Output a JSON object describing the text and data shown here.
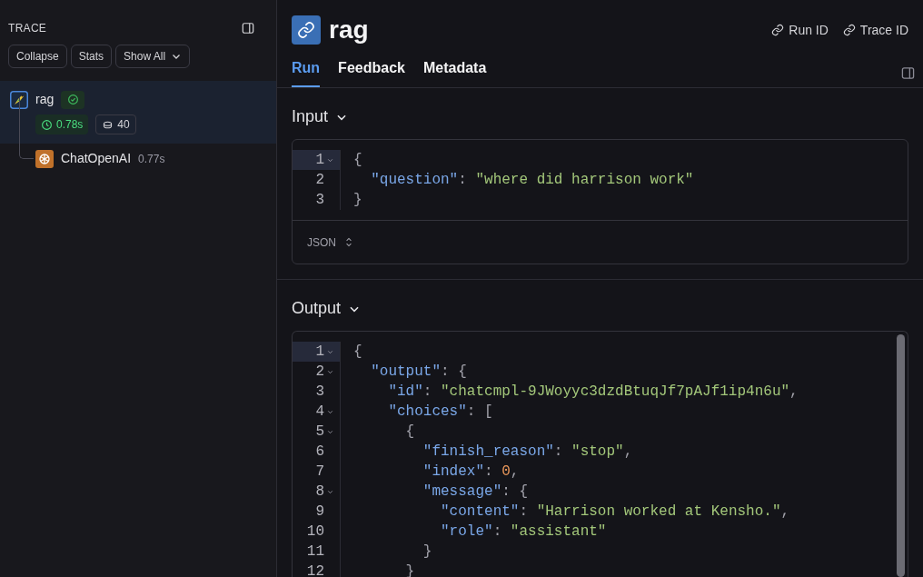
{
  "sidebar": {
    "title": "TRACE",
    "buttons": [
      {
        "label": "Collapse",
        "kind": "plain"
      },
      {
        "label": "Stats",
        "kind": "plain"
      },
      {
        "label": "Show All",
        "kind": "dropdown"
      }
    ],
    "runs": [
      {
        "name": "rag",
        "kind": "chain",
        "selected": true,
        "success": true,
        "latency": "0.78s",
        "tokens": "40",
        "children": [
          {
            "name": "ChatOpenAI",
            "kind": "llm",
            "selected": false,
            "latency": "0.77s"
          }
        ]
      }
    ]
  },
  "header": {
    "title": "rag",
    "links": [
      "Run ID",
      "Trace ID"
    ]
  },
  "tabs": [
    {
      "label": "Run",
      "selected": true
    },
    {
      "label": "Feedback",
      "selected": false
    },
    {
      "label": "Metadata",
      "selected": false
    }
  ],
  "sections": [
    {
      "title": "Input",
      "format": "JSON",
      "lines": [
        {
          "number": "1",
          "foldable": true,
          "active": true,
          "tokens": [
            {
              "kind": "punct",
              "text": "{"
            }
          ]
        },
        {
          "number": "2",
          "foldable": false,
          "active": false,
          "tokens": [
            {
              "kind": "key",
              "text": "  \"question\""
            },
            {
              "kind": "punct",
              "text": ": "
            },
            {
              "kind": "string",
              "text": "\"where did harrison work\""
            }
          ]
        },
        {
          "number": "3",
          "foldable": false,
          "active": false,
          "tokens": [
            {
              "kind": "punct",
              "text": "}"
            }
          ]
        }
      ]
    },
    {
      "title": "Output",
      "lines": [
        {
          "number": "1",
          "foldable": true,
          "active": true,
          "tokens": [
            {
              "kind": "punct",
              "text": "{"
            }
          ]
        },
        {
          "number": "2",
          "foldable": true,
          "active": false,
          "tokens": [
            {
              "kind": "key",
              "text": "  \"output\""
            },
            {
              "kind": "punct",
              "text": ": {"
            }
          ]
        },
        {
          "number": "3",
          "foldable": false,
          "active": false,
          "tokens": [
            {
              "kind": "key",
              "text": "    \"id\""
            },
            {
              "kind": "punct",
              "text": ": "
            },
            {
              "kind": "string",
              "text": "\"chatcmpl-9JWoyyc3dzdBtuqJf7pAJf1ip4n6u\""
            },
            {
              "kind": "punct",
              "text": ","
            }
          ]
        },
        {
          "number": "4",
          "foldable": true,
          "active": false,
          "tokens": [
            {
              "kind": "key",
              "text": "    \"choices\""
            },
            {
              "kind": "punct",
              "text": ": ["
            }
          ]
        },
        {
          "number": "5",
          "foldable": true,
          "active": false,
          "tokens": [
            {
              "kind": "punct",
              "text": "      {"
            }
          ]
        },
        {
          "number": "6",
          "foldable": false,
          "active": false,
          "tokens": [
            {
              "kind": "key",
              "text": "        \"finish_reason\""
            },
            {
              "kind": "punct",
              "text": ": "
            },
            {
              "kind": "string",
              "text": "\"stop\""
            },
            {
              "kind": "punct",
              "text": ","
            }
          ]
        },
        {
          "number": "7",
          "foldable": false,
          "active": false,
          "tokens": [
            {
              "kind": "key",
              "text": "        \"index\""
            },
            {
              "kind": "punct",
              "text": ": "
            },
            {
              "kind": "number",
              "text": "0"
            },
            {
              "kind": "punct",
              "text": ","
            }
          ]
        },
        {
          "number": "8",
          "foldable": true,
          "active": false,
          "tokens": [
            {
              "kind": "key",
              "text": "        \"message\""
            },
            {
              "kind": "punct",
              "text": ": {"
            }
          ]
        },
        {
          "number": "9",
          "foldable": false,
          "active": false,
          "tokens": [
            {
              "kind": "key",
              "text": "          \"content\""
            },
            {
              "kind": "punct",
              "text": ": "
            },
            {
              "kind": "string",
              "text": "\"Harrison worked at Kensho.\""
            },
            {
              "kind": "punct",
              "text": ","
            }
          ]
        },
        {
          "number": "10",
          "foldable": false,
          "active": false,
          "tokens": [
            {
              "kind": "key",
              "text": "          \"role\""
            },
            {
              "kind": "punct",
              "text": ": "
            },
            {
              "kind": "string",
              "text": "\"assistant\""
            }
          ]
        },
        {
          "number": "11",
          "foldable": false,
          "active": false,
          "tokens": [
            {
              "kind": "punct",
              "text": "        }"
            }
          ]
        },
        {
          "number": "12",
          "foldable": false,
          "active": false,
          "tokens": [
            {
              "kind": "punct",
              "text": "      }"
            }
          ]
        }
      ]
    }
  ]
}
